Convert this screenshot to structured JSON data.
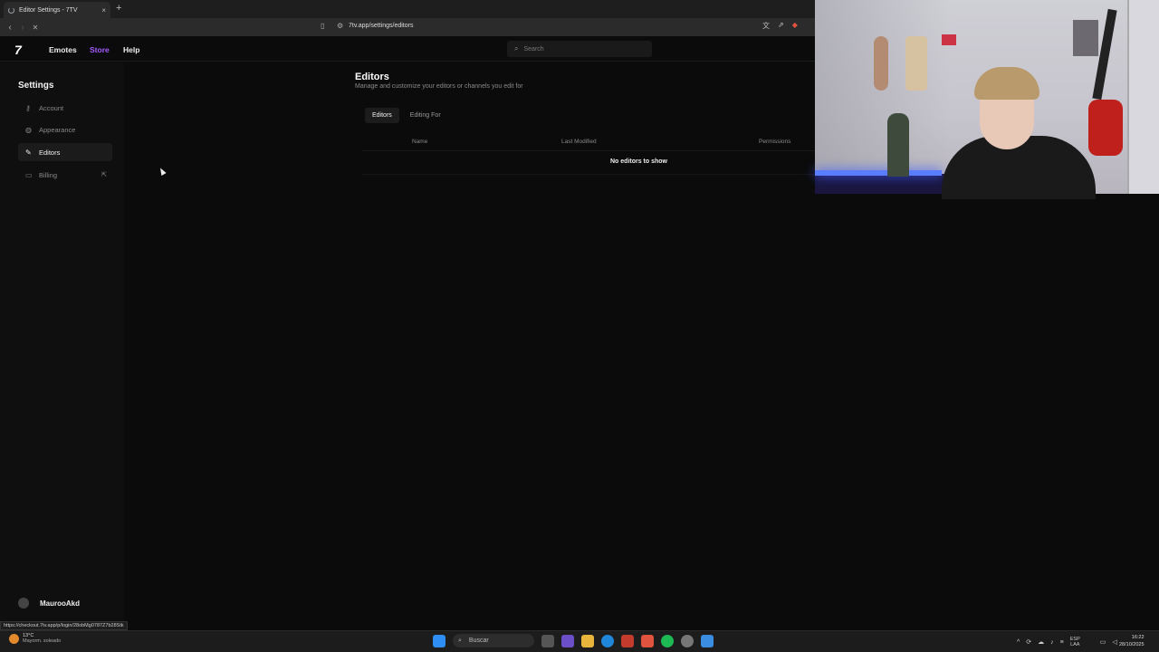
{
  "browser": {
    "tab_title": "Editor Settings - 7TV",
    "tab_close": "×",
    "new_tab": "+",
    "back": "‹",
    "forward": "›",
    "reload": "✕",
    "url": "7tv.app/settings/editors",
    "status_url": "https://checkout.7tv.app/p/login/28obMg0787Z7b28Stk"
  },
  "app": {
    "logo": "7",
    "nav": {
      "emotes": "Emotes",
      "store": "Store",
      "help": "Help"
    },
    "search_placeholder": "Search",
    "accent_color": "#a55cff"
  },
  "sidebar": {
    "title": "Settings",
    "items": [
      {
        "label": "Account",
        "icon": "key-icon"
      },
      {
        "label": "Appearance",
        "icon": "palette-icon"
      },
      {
        "label": "Editors",
        "icon": "pencil-icon",
        "active": true
      },
      {
        "label": "Billing",
        "icon": "card-icon",
        "external": true
      }
    ],
    "user": "MaurooAkd"
  },
  "main": {
    "title": "Editors",
    "subtitle": "Manage and customize your editors or channels you edit for",
    "tabs": [
      "Editors",
      "Editing For"
    ],
    "columns": {
      "name": "Name",
      "last_modified": "Last Modified",
      "permissions": "Permissions"
    },
    "empty_text": "No editors to show"
  },
  "taskbar": {
    "weather_temp": "13°C",
    "weather_desc": "Mayorm. soleado",
    "search_label": "Buscar",
    "lang_top": "ESP",
    "lang_bottom": "LAA",
    "time": "16:22",
    "date": "28/10/2025"
  }
}
